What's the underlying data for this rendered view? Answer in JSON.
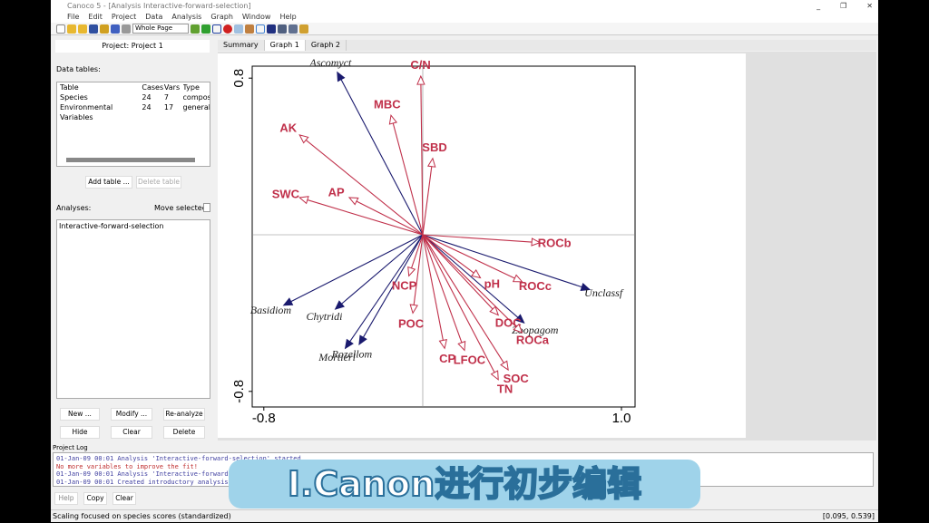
{
  "window": {
    "title": "Canoco 5 - [Analysis Interactive-forward-selection]",
    "controls": [
      "_",
      "❐",
      "✕"
    ]
  },
  "menu": [
    "File",
    "Edit",
    "Project",
    "Data",
    "Analysis",
    "Graph",
    "Window",
    "Help"
  ],
  "toolbar": {
    "zoom_select": "Whole Page"
  },
  "project": {
    "title": "Project: Project 1",
    "data_tables_label": "Data tables:",
    "table_headers": [
      "Table",
      "Cases",
      "Vars",
      "Type"
    ],
    "tables": [
      [
        "Species",
        "24",
        "7",
        "compos"
      ],
      [
        "Environmental Variables",
        "24",
        "17",
        "general"
      ]
    ],
    "add_table": "Add table ...",
    "delete_table": "Delete table",
    "analyses_label": "Analyses:",
    "move_selected": "Move selected:",
    "analyses": [
      "Interactive-forward-selection"
    ],
    "buttons": [
      "New ...",
      "Modify ...",
      "Re-analyze",
      "Hide",
      "Clear",
      "Delete"
    ]
  },
  "tabs": [
    "Summary",
    "Graph 1",
    "Graph 2"
  ],
  "active_tab": "Graph 1",
  "chart_data": {
    "type": "biplot",
    "xlim": [
      -0.8,
      1.0
    ],
    "ylim": [
      -0.8,
      0.8
    ],
    "xticks": [
      "-0.8",
      "1.0"
    ],
    "yticks": [
      "0.8",
      "-0.8"
    ],
    "species_color": "#1a1a6e",
    "env_color": "#c0304a",
    "species": [
      {
        "name": "Ascomyct",
        "x": -0.43,
        "y": 0.83
      },
      {
        "name": "Basidiom",
        "x": -0.7,
        "y": -0.36
      },
      {
        "name": "Chytridi",
        "x": -0.44,
        "y": -0.38
      },
      {
        "name": "Mortierl",
        "x": -0.39,
        "y": -0.58
      },
      {
        "name": "Rozellom",
        "x": -0.32,
        "y": -0.56
      },
      {
        "name": "Unclassf",
        "x": 0.84,
        "y": -0.28
      },
      {
        "name": "Zoopagom",
        "x": 0.51,
        "y": -0.45
      }
    ],
    "env": [
      {
        "name": "C/N",
        "x": -0.01,
        "y": 0.81
      },
      {
        "name": "MBC",
        "x": -0.16,
        "y": 0.61
      },
      {
        "name": "AK",
        "x": -0.62,
        "y": 0.51
      },
      {
        "name": "SBD",
        "x": 0.05,
        "y": 0.39
      },
      {
        "name": "AP",
        "x": -0.37,
        "y": 0.19
      },
      {
        "name": "SWC",
        "x": -0.62,
        "y": 0.19
      },
      {
        "name": "ROCb",
        "x": 0.59,
        "y": -0.04
      },
      {
        "name": "pH",
        "x": 0.29,
        "y": -0.22
      },
      {
        "name": "ROCc",
        "x": 0.5,
        "y": -0.24
      },
      {
        "name": "NCP",
        "x": -0.07,
        "y": -0.21
      },
      {
        "name": "POC",
        "x": -0.05,
        "y": -0.4
      },
      {
        "name": "DOC",
        "x": 0.38,
        "y": -0.41
      },
      {
        "name": "ROCa",
        "x": 0.5,
        "y": -0.5
      },
      {
        "name": "CP",
        "x": 0.11,
        "y": -0.58
      },
      {
        "name": "LFOC",
        "x": 0.21,
        "y": -0.59
      },
      {
        "name": "SOC",
        "x": 0.43,
        "y": -0.69
      },
      {
        "name": "TN",
        "x": 0.38,
        "y": -0.74
      }
    ]
  },
  "log": {
    "title": "Project Log",
    "lines": [
      {
        "text": "01-Jan-09 00:01 Analysis 'Interactive-forward-selection' started",
        "color": "#4040a0"
      },
      {
        "text": "No more variables to improve the fit!",
        "color": "#c03030"
      },
      {
        "text": "01-Jan-09 00:01 Analysis 'Interactive-forward-selection' ...",
        "color": "#4040a0"
      },
      {
        "text": "01-Jan-09 00:01 Created introductory analysis",
        "color": "#4040a0"
      }
    ],
    "buttons": [
      "Help",
      "Copy",
      "Clear"
    ]
  },
  "status": {
    "left": "Scaling focused on species scores (standardized)",
    "right": "[0.095, 0.539]"
  },
  "caption": "I.Canon进行初步编辑"
}
